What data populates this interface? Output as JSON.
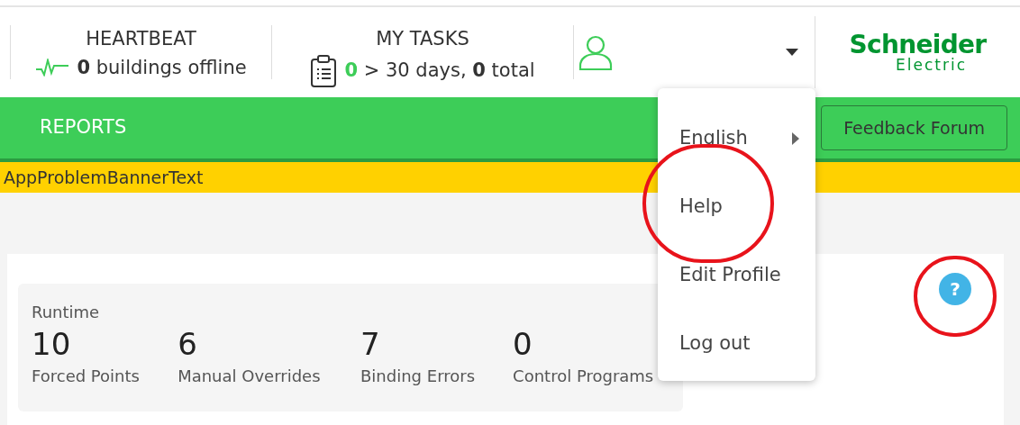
{
  "header": {
    "heartbeat": {
      "title": "HEARTBEAT",
      "count": "0",
      "text": "buildings offline"
    },
    "tasks": {
      "title": "MY TASKS",
      "overdue": "0",
      "overdue_text": "> 30 days,",
      "total": "0",
      "total_text": "total"
    },
    "logo": {
      "line_1": "Schneider",
      "line_2": "Electric"
    }
  },
  "nav": {
    "items": [
      {
        "label": "REPORTS"
      }
    ],
    "feedback_button": "Feedback Forum"
  },
  "banner": "AppProblemBannerText",
  "user_menu": {
    "open": true,
    "items": [
      {
        "label": "English",
        "submenu": true
      },
      {
        "label": "Help",
        "submenu": false
      },
      {
        "label": "Edit Profile",
        "submenu": false
      },
      {
        "label": "Log out",
        "submenu": false
      }
    ]
  },
  "runtime": {
    "title": "Runtime",
    "stats": [
      {
        "value": "10",
        "label": "Forced Points"
      },
      {
        "value": "6",
        "label": "Manual Overrides"
      },
      {
        "value": "7",
        "label": "Binding Errors"
      },
      {
        "value": "0",
        "label": "Control Programs"
      }
    ]
  },
  "help_button": "?",
  "annotations": [
    {
      "kind": "circle"
    },
    {
      "kind": "circle"
    }
  ]
}
